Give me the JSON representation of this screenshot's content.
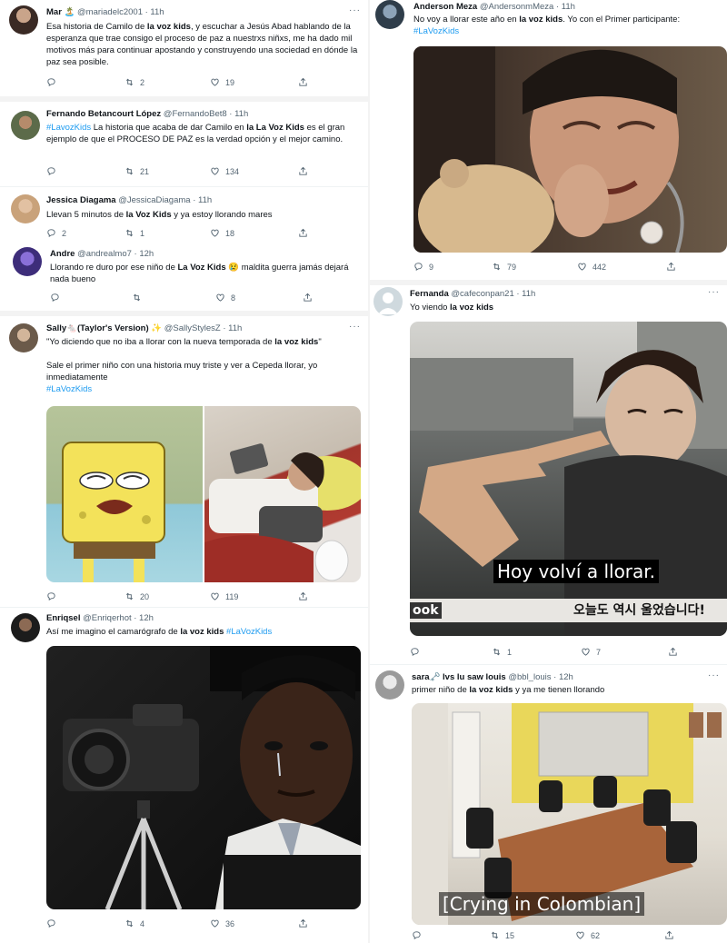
{
  "left": {
    "tweets": [
      {
        "name": "Mar 🏝️",
        "handle": "@mariadelc2001 · 11h",
        "parts": [
          "Esa historia de Camilo de ",
          "la voz kids",
          ", y escuchar a Jesús Abad hablando de la esperanza que trae consigo el proceso de paz a nuestrxs niñxs, me ha dado mil motivos más para continuar apostando y construyendo una sociedad en dónde la paz sea posible."
        ],
        "reply": "",
        "retweet": "2",
        "like": "19"
      },
      {
        "name": "Fernando Betancourt López",
        "handle": "@FernandoBet8 · 11h",
        "tag": "#LavozKids",
        "parts": [
          " La historia que acaba de dar Camilo en ",
          "la La Voz Kids",
          " es el gran ejemplo de que el PROCESO DE PAZ es la verdad opción y el mejor camino."
        ],
        "reply": "",
        "retweet": "21",
        "like": "134"
      },
      {
        "name": "Jessica Diagama",
        "handle": "@JessicaDiagama · 11h",
        "parts": [
          "Llevan 5 minutos de ",
          "la Voz Kids",
          " y ya estoy llorando mares"
        ],
        "reply": "2",
        "retweet": "1",
        "like": "18"
      },
      {
        "name": "Andre",
        "handle": "@andrealmo7 · 12h",
        "parts": [
          "Llorando re duro por ese niño de ",
          "La Voz Kids",
          " 😢 maldita guerra jamás dejará nada bueno"
        ],
        "reply": "",
        "retweet": "",
        "like": "8"
      },
      {
        "name": "Sally🐁(Taylor's Version) ✨",
        "handle": "@SallyStylesZ · 11h",
        "line1": [
          "\"Yo diciendo que no iba a llorar con la nueva temporada de ",
          "la voz kids",
          "\""
        ],
        "line2": "Sale el primer niño con una historia muy triste y ver a Cepeda llorar, yo inmediatamente",
        "tag": "#LaVozKids",
        "reply": "",
        "retweet": "20",
        "like": "119"
      },
      {
        "name": "Enriqsel",
        "handle": "@Enriqerhot · 12h",
        "parts": [
          "Así me imagino el camarógrafo de ",
          "la voz kids",
          " "
        ],
        "tag": "#LaVozKids",
        "reply": "",
        "retweet": "4",
        "like": "36"
      }
    ]
  },
  "right": {
    "tweets": [
      {
        "name": "Anderson Meza",
        "handle": "@AndersonmMeza · 11h",
        "parts": [
          "No voy a llorar este año en ",
          "la voz kids",
          ". Yo con el Primer participante:"
        ],
        "tag": "#LaVozKids",
        "reply": "9",
        "retweet": "79",
        "like": "442"
      },
      {
        "name": "Fernanda",
        "handle": "@cafeconpan21 · 11h",
        "parts": [
          "Yo viendo ",
          "la voz kids",
          ""
        ],
        "caption": "Hoy volví a llorar.",
        "caption2": "오늘도 역시 울었습니다!",
        "caption_left": "ook",
        "reply": "",
        "retweet": "1",
        "like": "7"
      },
      {
        "name": "sara🗝️ lvs lu saw louis",
        "handle": "@bbl_louis · 12h",
        "parts": [
          "primer niño de ",
          "la voz kids",
          " y ya me tienen llorando"
        ],
        "caption": "[Crying in Colombian]",
        "reply": "",
        "retweet": "15",
        "like": "62"
      }
    ]
  },
  "icons": {
    "reply": "reply-icon",
    "retweet": "retweet-icon",
    "like": "heart-icon",
    "share": "share-icon",
    "more": "more-icon"
  },
  "colors": {
    "link": "#1d9bf0",
    "text": "#0f1419",
    "muted": "#536471"
  }
}
